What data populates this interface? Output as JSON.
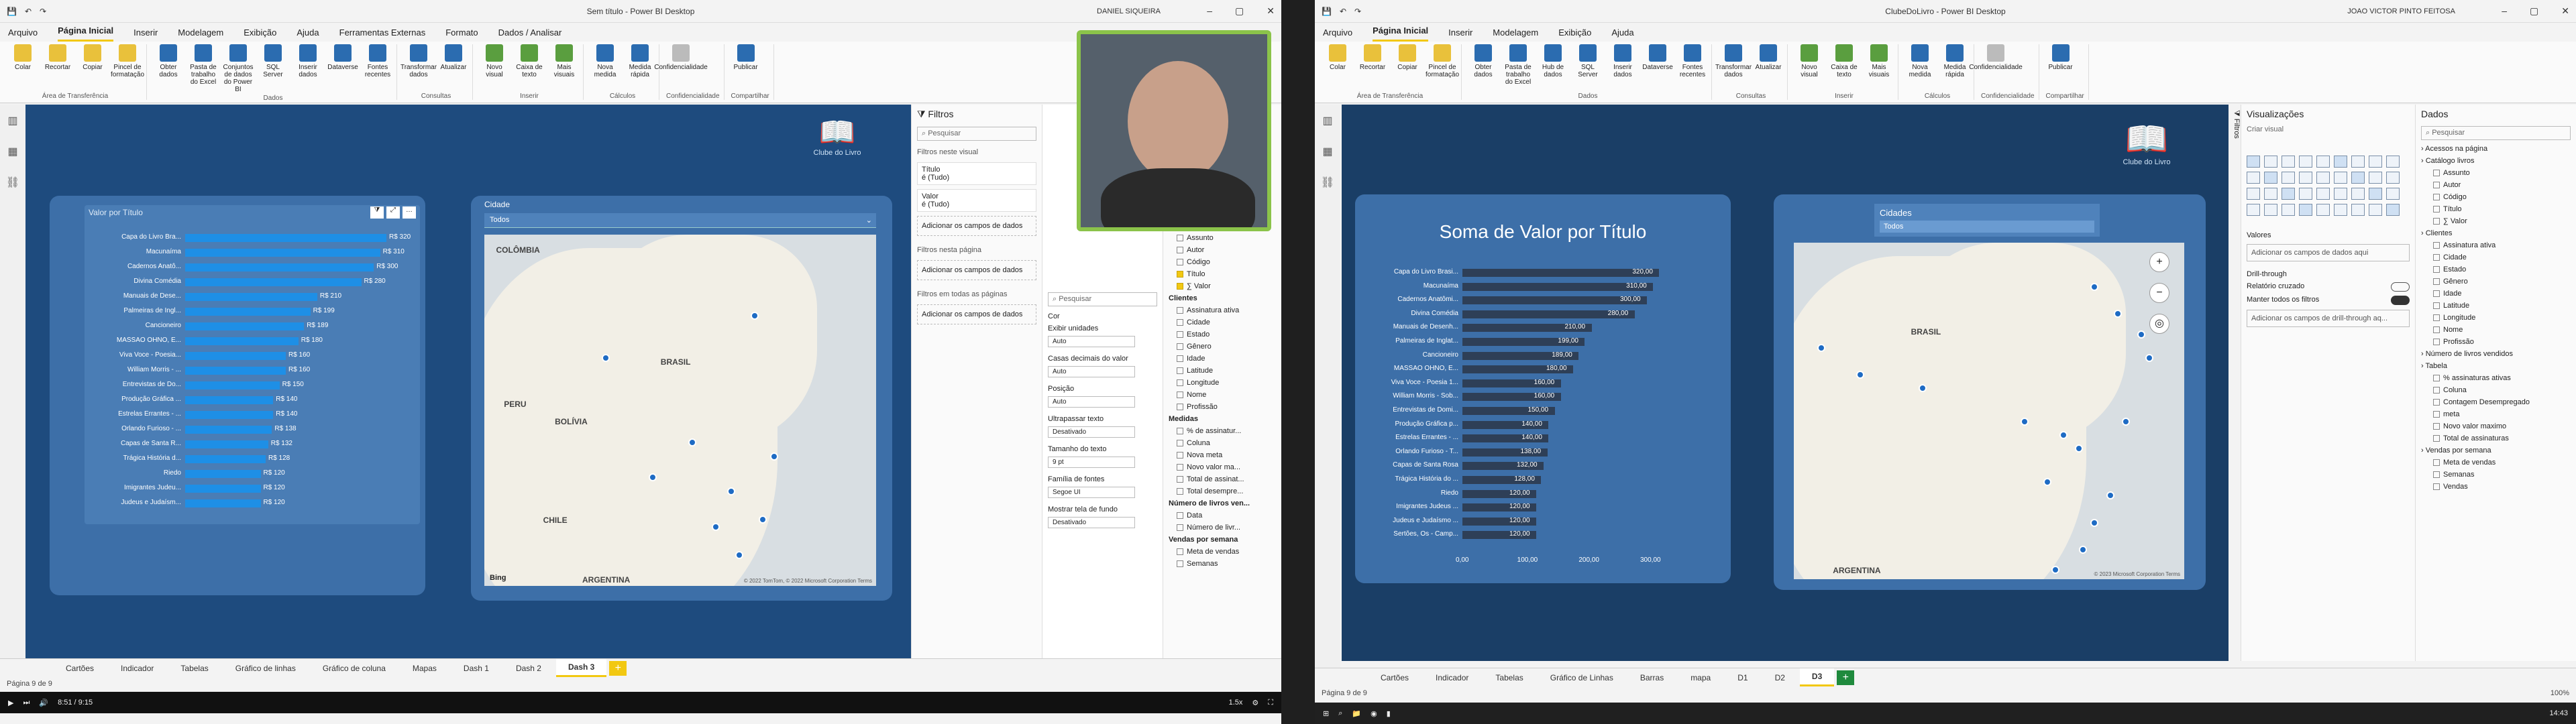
{
  "left": {
    "title": "Sem título - Power BI Desktop",
    "user": "DANIEL SIQUEIRA",
    "menus": [
      "Arquivo",
      "Página Inicial",
      "Inserir",
      "Modelagem",
      "Exibição",
      "Ajuda",
      "Ferramentas Externas",
      "Formato",
      "Dados / Analisar"
    ],
    "ribbon": [
      {
        "name": "Área de Transferência",
        "buttons": [
          "Colar",
          "Recortar",
          "Copiar",
          "Pincel de formatação"
        ]
      },
      {
        "name": "Dados",
        "buttons": [
          "Obter dados",
          "Pasta de trabalho do Excel",
          "Conjuntos de dados do Power BI",
          "SQL Server",
          "Inserir dados",
          "Dataverse",
          "Fontes recentes"
        ]
      },
      {
        "name": "Consultas",
        "buttons": [
          "Transformar dados",
          "Atualizar"
        ]
      },
      {
        "name": "Inserir",
        "buttons": [
          "Novo visual",
          "Caixa de texto",
          "Mais visuais"
        ]
      },
      {
        "name": "Cálculos",
        "buttons": [
          "Nova medida",
          "Medida rápida"
        ]
      },
      {
        "name": "Confidencialidade",
        "buttons": [
          "Confidencialidade"
        ]
      },
      {
        "name": "Compartilhar",
        "buttons": [
          "Publicar"
        ]
      }
    ],
    "logo_text": "Clube do Livro",
    "chart_title": "Valor por Título",
    "slicer_title": "Cidade",
    "slicer_value": "Todos",
    "map_labels": [
      "COLÔMBIA",
      "BRASIL",
      "PERU",
      "BOLÍVIA",
      "CHILE",
      "ARGENTINA"
    ],
    "map_credit": "© 2022 TomTom, © 2022 Microsoft Corporation Terms",
    "bing": "Bing",
    "filters": {
      "title": "Filtros",
      "search": "Pesquisar",
      "on_visual": "Filtros neste visual",
      "items": [
        {
          "name": "Título",
          "value": "é (Tudo)"
        },
        {
          "name": "Valor",
          "value": "é (Tudo)"
        }
      ],
      "add": "Adicionar os campos de dados",
      "on_page": "Filtros nesta página",
      "on_all": "Filtros em todas as páginas"
    },
    "format": {
      "search": "Pesquisar",
      "cor": "Cor",
      "units_label": "Exibir unidades",
      "units": "Auto",
      "decimals_label": "Casas decimais do valor",
      "decimals": "Auto",
      "position_label": "Posição",
      "position": "Auto",
      "overflow_label": "Ultrapassar texto",
      "overflow": "Desativado",
      "size_label": "Tamanho do texto",
      "size": "9 pt",
      "family_label": "Família de fontes",
      "family": "Segoe UI",
      "bg_label": "Mostrar tela de fundo",
      "bg": "Desativado"
    },
    "fields": [
      "Assunto",
      "Autor",
      "Código",
      "Título",
      "∑ Valor",
      "Clientes",
      "Assinatura ativa",
      "Cidade",
      "Estado",
      "Gênero",
      "Idade",
      "Latitude",
      "Longitude",
      "Nome",
      "Profissão",
      "Medidas",
      "% de assinatur...",
      "Coluna",
      "Nova meta",
      "Novo valor ma...",
      "Total de assinat...",
      "Total desempre...",
      "Número de livros ven...",
      "Data",
      "Número de livr...",
      "Vendas por semana",
      "Meta de vendas",
      "Semanas"
    ],
    "fields_checked": [
      "Título",
      "∑ Valor"
    ],
    "tabs": [
      "Cartões",
      "Indicador",
      "Tabelas",
      "Gráfico de linhas",
      "Gráfico de coluna",
      "Mapas",
      "Dash 1",
      "Dash 2",
      "Dash 3"
    ],
    "active_tab": "Dash 3",
    "page": "Página 9 de 9",
    "player": {
      "time": "8:51 / 9:15",
      "speed": "1.5x"
    }
  },
  "right": {
    "title": "ClubeDoLivro - Power BI Desktop",
    "user": "JOAO VICTOR PINTO FEITOSA",
    "menus": [
      "Arquivo",
      "Página Inicial",
      "Inserir",
      "Modelagem",
      "Exibição",
      "Ajuda"
    ],
    "ribbon": [
      {
        "name": "Área de Transferência",
        "buttons": [
          "Colar",
          "Recortar",
          "Copiar",
          "Pincel de formatação"
        ]
      },
      {
        "name": "Dados",
        "buttons": [
          "Obter dados",
          "Pasta de trabalho do Excel",
          "Hub de dados",
          "SQL Server",
          "Inserir dados",
          "Dataverse",
          "Fontes recentes"
        ]
      },
      {
        "name": "Consultas",
        "buttons": [
          "Transformar dados",
          "Atualizar"
        ]
      },
      {
        "name": "Inserir",
        "buttons": [
          "Novo visual",
          "Caixa de texto",
          "Mais visuais"
        ]
      },
      {
        "name": "Cálculos",
        "buttons": [
          "Nova medida",
          "Medida rápida"
        ]
      },
      {
        "name": "Confidencialidade",
        "buttons": [
          "Confidencialidade"
        ]
      },
      {
        "name": "Compartilhar",
        "buttons": [
          "Publicar"
        ]
      }
    ],
    "logo_text": "Clube do Livro",
    "chart_title": "Soma de Valor por Título",
    "slicer_title": "Cidades",
    "slicer_value": "Todos",
    "map_labels": [
      "BRASIL",
      "ARGENTINA"
    ],
    "map_credit": "© 2023 Microsoft Corporation Terms",
    "vis_title": "Visualizações",
    "vis_sub": "Criar visual",
    "vis_values": "Valores",
    "vis_add": "Adicionar os campos de dados aqui",
    "drill": "Drill-through",
    "drill_report": "Relatório cruzado",
    "drill_keep": "Manter todos os filtros",
    "drill_add": "Adicionar os campos de drill-through aq...",
    "data_title": "Dados",
    "data_search": "Pesquisar",
    "data_fields": [
      "Acessos na página",
      "Catálogo livros",
      "Assunto",
      "Autor",
      "Código",
      "Título",
      "∑ Valor",
      "Clientes",
      "Assinatura ativa",
      "Cidade",
      "Estado",
      "Gênero",
      "Idade",
      "Latitude",
      "Longitude",
      "Nome",
      "Profissão",
      "Número de livros vendidos",
      "Tabela",
      "% assinaturas ativas",
      "Coluna",
      "Contagem Desempregado",
      "meta",
      "Novo valor maximo",
      "Total de assinaturas",
      "Vendas por semana",
      "Meta de vendas",
      "Semanas",
      "Vendas"
    ],
    "tabs": [
      "Cartões",
      "Indicador",
      "Tabelas",
      "Gráfico de Linhas",
      "Barras",
      "mapa",
      "D1",
      "D2",
      "D3"
    ],
    "active_tab": "D3",
    "page": "Página 9 de 9",
    "zoom": "100%",
    "clock": "14:43"
  },
  "chart_data": [
    {
      "type": "bar",
      "title": "Valor por Título",
      "categories": [
        "Capa do Livro Bra...",
        "Macunaíma",
        "Cadernos Anatô...",
        "Divina Comédia",
        "Manuais de Dese...",
        "Palmeiras de Ingl...",
        "Cancioneiro",
        "MASSAO OHNO, E...",
        "Viva Voce - Poesia...",
        "William Morris - ...",
        "Entrevistas de Do...",
        "Produção Gráfica ...",
        "Estrelas Errantes - ...",
        "Orlando Furioso - ...",
        "Capas de Santa R...",
        "Trágica História d...",
        "Riedo",
        "Imigrantes Judeu...",
        "Judeus e Judaísm..."
      ],
      "values": [
        320,
        310,
        300,
        280,
        210,
        199,
        189,
        180,
        160,
        160,
        150,
        140,
        140,
        138,
        132,
        128,
        120,
        120,
        120
      ],
      "value_labels": [
        "R$ 320",
        "R$ 310",
        "R$ 300",
        "R$ 280",
        "R$ 210",
        "R$ 199",
        "R$ 189",
        "R$ 180",
        "R$ 160",
        "R$ 160",
        "R$ 150",
        "R$ 140",
        "R$ 140",
        "R$ 138",
        "R$ 132",
        "R$ 128",
        "R$ 120",
        "R$ 120",
        "R$ 120"
      ],
      "xlim": [
        0,
        320
      ]
    },
    {
      "type": "bar",
      "title": "Soma de Valor por Título",
      "categories": [
        "Capa do Livro Brasi...",
        "Macunaíma",
        "Cadernos Anatômi...",
        "Divina Comédia",
        "Manuais de Desenh...",
        "Palmeiras de Inglat...",
        "Cancioneiro",
        "MASSAO OHNO, E...",
        "Viva Voce - Poesia 1...",
        "William Morris - Sob...",
        "Entrevistas de Domi...",
        "Produção Gráfica p...",
        "Estrelas Errantes - ...",
        "Orlando Furioso - T...",
        "Capas de Santa Rosa",
        "Trágica História do ...",
        "Riedo",
        "Imigrantes Judeus ...",
        "Judeus e Judaísmo ...",
        "Sertões, Os - Camp..."
      ],
      "values": [
        320,
        310,
        300,
        280,
        210,
        199,
        189,
        180,
        160,
        160,
        150,
        140,
        140,
        138,
        132,
        128,
        120,
        120,
        120,
        120
      ],
      "value_labels": [
        "320,00",
        "310,00",
        "300,00",
        "280,00",
        "210,00",
        "199,00",
        "189,00",
        "180,00",
        "160,00",
        "160,00",
        "150,00",
        "140,00",
        "140,00",
        "138,00",
        "132,00",
        "128,00",
        "120,00",
        "120,00",
        "120,00",
        "120,00"
      ],
      "xticks": [
        "0,00",
        "100,00",
        "200,00",
        "300,00"
      ],
      "xlim": [
        0,
        360
      ]
    }
  ]
}
